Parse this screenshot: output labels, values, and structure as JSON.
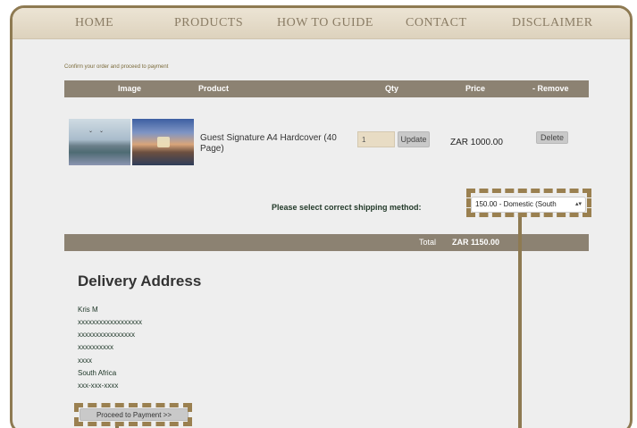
{
  "nav": {
    "items": [
      "HOME",
      "PRODUCTS",
      "HOW TO GUIDE",
      "CONTACT",
      "DISCLAIMER"
    ]
  },
  "breadcrumb": "Confirm your order and proceed to payment",
  "table": {
    "headers": {
      "image": "Image",
      "product": "Product",
      "qty": "Qty",
      "price": "Price",
      "remove": "- Remove"
    },
    "row": {
      "product": "Guest Signature A4 Hardcover (40 Page)",
      "qty": "1",
      "update_label": "Update",
      "price": "ZAR 1000.00",
      "delete_label": "Delete"
    }
  },
  "shipping": {
    "label": "Please select correct shipping method:",
    "selected": "150.00 - Domestic (South"
  },
  "total": {
    "label": "Total",
    "value": "ZAR 1150.00"
  },
  "delivery": {
    "title": "Delivery Address",
    "lines": [
      "Kris M",
      "xxxxxxxxxxxxxxxxxx",
      "xxxxxxxxxxxxxxxx",
      "xxxxxxxxxx",
      "xxxx",
      "South Africa",
      "xxx-xxx-xxxx"
    ]
  },
  "proceed_label": "Proceed to Payment >>",
  "colors": {
    "accent": "#8e7a52",
    "table_header": "#8c8272",
    "page_bg": "#eeeeee"
  }
}
